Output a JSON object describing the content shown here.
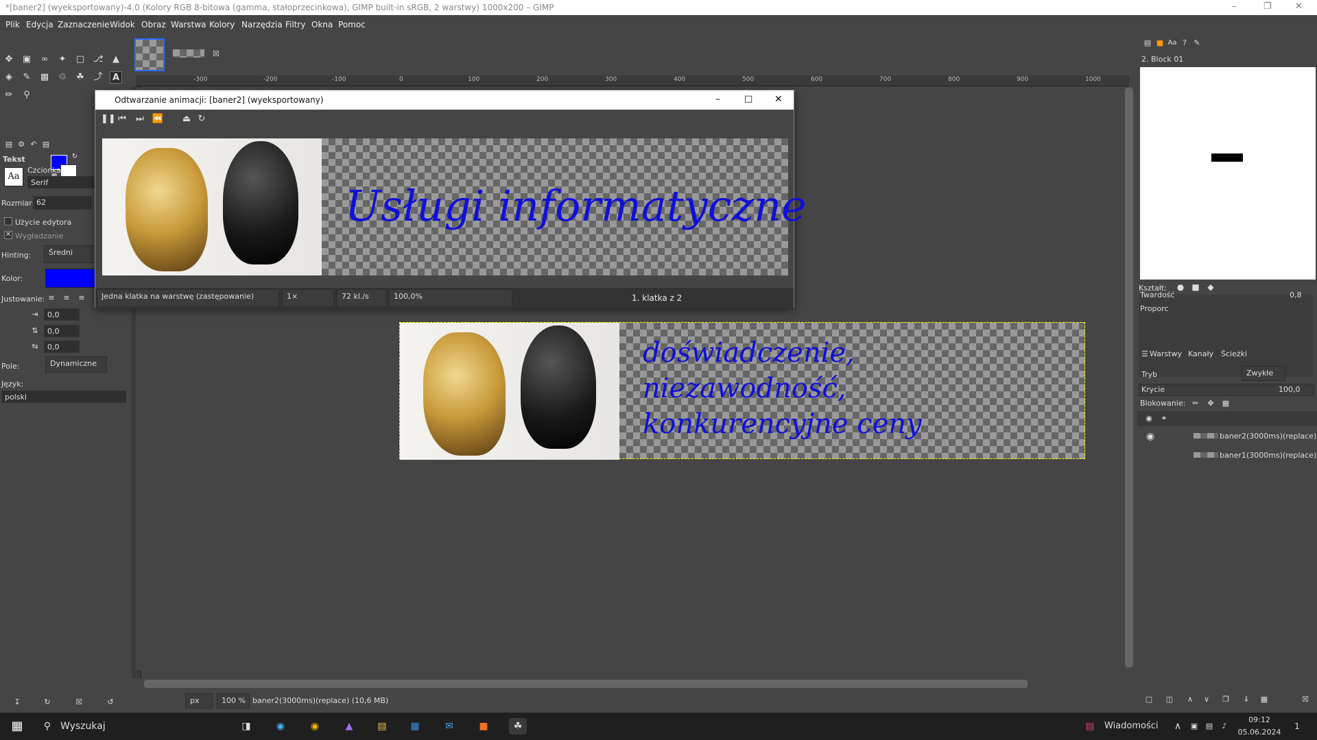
{
  "window": {
    "title": "*[baner2] (wyeksportowany)-4.0 (Kolory RGB 8-bitowa (gamma, stałoprzecinkowa), GIMP built-in sRGB, 2 warstwy) 1000x200 – GIMP"
  },
  "menu": [
    "Plik",
    "Edycja",
    "Zaznaczenie",
    "Widok",
    "Obraz",
    "Warstwa",
    "Kolory",
    "Narzędzia",
    "Filtry",
    "Okna",
    "Pomoc"
  ],
  "tool_options": {
    "title": "Tekst",
    "font_label": "Czcionka",
    "font_value": "Serif",
    "aa_label": "Aa",
    "size_label": "Rozmiar:",
    "size_value": "62",
    "use_editor": "Użycie edytora",
    "antialias": "Wygładzanie",
    "hinting_label": "Hinting:",
    "hinting_value": "Średni",
    "color_label": "Kolor:",
    "justify_label": "Justowanie:",
    "indent1": "0,0",
    "indent2": "0,0",
    "indent3": "0,0",
    "box_label": "Pole:",
    "box_value": "Dynamiczne",
    "lang_label": "Język:",
    "lang_value": "polski",
    "fg_color": "#0000ff"
  },
  "ruler": {
    "h_ticks": [
      "-300",
      "-200",
      "-100",
      "0",
      "100",
      "200",
      "300",
      "400",
      "500",
      "600",
      "700",
      "800",
      "900",
      "1000"
    ]
  },
  "anim": {
    "title": "Odtwarzanie animacji: [baner2] (wyeksportowany)",
    "frame_text": "Usługi informatyczne",
    "mode": "Jedna klatka na warstwę (zastępowanie)",
    "speed": "1×",
    "fps": "72 kl./s",
    "zoom": "100,0%",
    "frame_counter": "1. klatka z 2"
  },
  "canvas": {
    "line1": "doświadczenie,",
    "line2": "niezawodność,",
    "line3": "konkurencyjne ceny"
  },
  "right": {
    "brush_name": "2. Block 01",
    "shape_label": "Kształt:",
    "hardness_label": "Twardość",
    "hardness_value": "0,8",
    "proportion_label": "Proporc",
    "tab_layers": "Warstwy",
    "tab_channels": "Kanały",
    "tab_paths": "Ścieżki",
    "mode_label": "Tryb",
    "mode_value": "Zwykłe",
    "opacity_label": "Krycie",
    "opacity_value": "100,0",
    "lock_label": "Blokowanie:",
    "layers": [
      "baner2(3000ms)(replace)",
      "baner1(3000ms)(replace)"
    ]
  },
  "status": {
    "unit": "px",
    "zoom": "100 %",
    "info": "baner2(3000ms)(replace) (10,6 MB)"
  },
  "taskbar": {
    "search": "Wyszukaj",
    "news": "Wiadomości",
    "time": "09:12",
    "date": "05.06.2024",
    "notif": "1"
  }
}
